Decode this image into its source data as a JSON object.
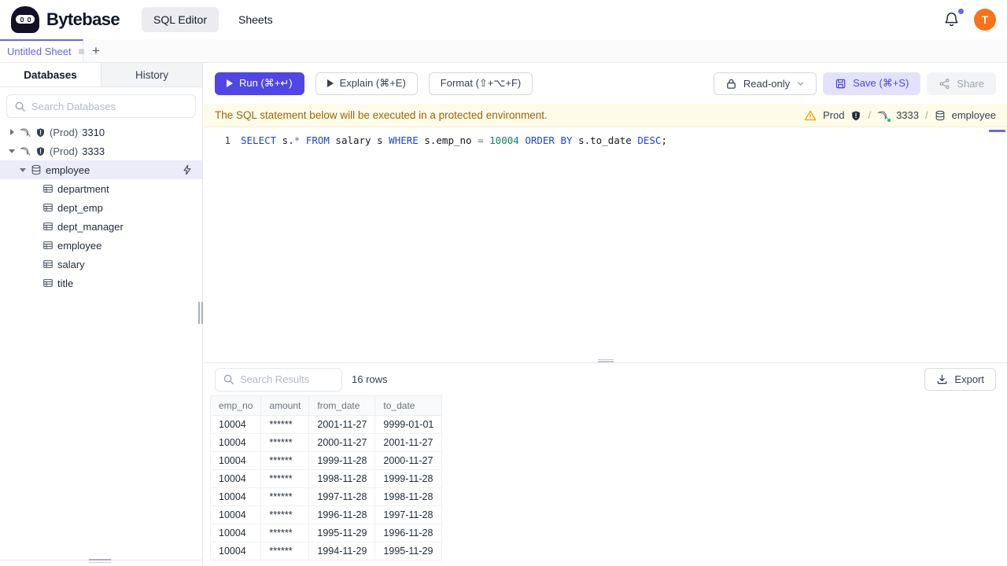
{
  "colors": {
    "accent": "#4f46e5",
    "accent_light": "#e4e2fb",
    "tab_accent": "#6366f1",
    "avatar_bg": "#f97316",
    "banner_bg": "#fdfce8",
    "banner_text": "#a16207",
    "warning": "#f59e0b",
    "instance_online": "#10b981",
    "sql_keyword": "#1b45d2",
    "sql_number": "#098658"
  },
  "header": {
    "brand": "Bytebase",
    "nav_sql_editor": "SQL Editor",
    "nav_sheets": "Sheets",
    "avatar_initial": "T"
  },
  "sheet_tabs": {
    "active_tab": "Untitled Sheet",
    "add_button": "+"
  },
  "sidebar": {
    "tab_databases": "Databases",
    "tab_history": "History",
    "search_placeholder": "Search Databases",
    "tree": [
      {
        "kind": "instance",
        "env": "(Prod)",
        "name": "3310",
        "expanded": false
      },
      {
        "kind": "instance",
        "env": "(Prod)",
        "name": "3333",
        "expanded": true
      },
      {
        "kind": "database",
        "name": "employee",
        "expanded": true,
        "selected": true
      },
      {
        "kind": "table",
        "name": "department"
      },
      {
        "kind": "table",
        "name": "dept_emp"
      },
      {
        "kind": "table",
        "name": "dept_manager"
      },
      {
        "kind": "table",
        "name": "employee"
      },
      {
        "kind": "table",
        "name": "salary"
      },
      {
        "kind": "table",
        "name": "title"
      }
    ]
  },
  "toolbar": {
    "run_label": "Run (⌘+↵)",
    "explain_label": "Explain (⌘+E)",
    "format_label": "Format (⇧+⌥+F)",
    "readonly_label": "Read-only",
    "save_label": "Save (⌘+S)",
    "share_label": "Share"
  },
  "banner": {
    "message": "The SQL statement below will be executed in a protected environment.",
    "environment": "Prod",
    "separator": "/",
    "instance": "3333",
    "database": "employee"
  },
  "editor": {
    "line_number": "1",
    "sql_text": "SELECT s.* FROM salary s WHERE s.emp_no = 10004 ORDER BY s.to_date DESC;",
    "tokens": [
      {
        "text": "SELECT",
        "type": "keyword"
      },
      {
        "text": " s.",
        "type": "plain"
      },
      {
        "text": "*",
        "type": "operator"
      },
      {
        "text": " ",
        "type": "plain"
      },
      {
        "text": "FROM",
        "type": "keyword"
      },
      {
        "text": " salary s ",
        "type": "plain"
      },
      {
        "text": "WHERE",
        "type": "keyword"
      },
      {
        "text": " s.emp_no ",
        "type": "plain"
      },
      {
        "text": "=",
        "type": "operator"
      },
      {
        "text": " ",
        "type": "plain"
      },
      {
        "text": "10004",
        "type": "number"
      },
      {
        "text": " ",
        "type": "plain"
      },
      {
        "text": "ORDER",
        "type": "keyword"
      },
      {
        "text": " ",
        "type": "plain"
      },
      {
        "text": "BY",
        "type": "keyword"
      },
      {
        "text": " s.to_date ",
        "type": "plain"
      },
      {
        "text": "DESC",
        "type": "keyword"
      },
      {
        "text": ";",
        "type": "plain"
      }
    ]
  },
  "results": {
    "search_placeholder": "Search Results",
    "row_count": "16 rows",
    "export_label": "Export",
    "columns": [
      "emp_no",
      "amount",
      "from_date",
      "to_date"
    ],
    "rows": [
      [
        "10004",
        "******",
        "2001-11-27",
        "9999-01-01"
      ],
      [
        "10004",
        "******",
        "2000-11-27",
        "2001-11-27"
      ],
      [
        "10004",
        "******",
        "1999-11-28",
        "2000-11-27"
      ],
      [
        "10004",
        "******",
        "1998-11-28",
        "1999-11-28"
      ],
      [
        "10004",
        "******",
        "1997-11-28",
        "1998-11-28"
      ],
      [
        "10004",
        "******",
        "1996-11-28",
        "1997-11-28"
      ],
      [
        "10004",
        "******",
        "1995-11-29",
        "1996-11-28"
      ],
      [
        "10004",
        "******",
        "1994-11-29",
        "1995-11-29"
      ]
    ]
  }
}
